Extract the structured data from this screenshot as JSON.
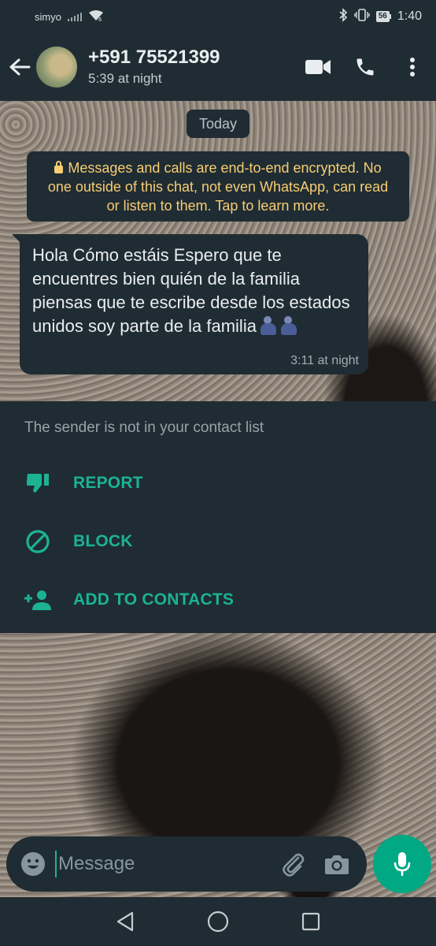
{
  "status_bar": {
    "carrier": "simyo",
    "battery": "56",
    "time": "1:40",
    "icons": [
      "signal-icon",
      "wifi-icon",
      "bluetooth-icon",
      "vibrate-icon",
      "battery-icon"
    ]
  },
  "header": {
    "contact_name": "+591 75521399",
    "contact_status": "5:39 at night",
    "icons": [
      "back-arrow-icon",
      "video-call-icon",
      "voice-call-icon",
      "more-vert-icon"
    ]
  },
  "chat": {
    "date_chip": "Today",
    "encryption_notice": "Messages and calls are end-to-end encrypted. No one outside of this chat, not even WhatsApp, can read or listen to them. Tap to learn more.",
    "messages": [
      {
        "direction": "incoming",
        "text": "Hola Cómo estáis Espero que te encuentres bien quién de la familia piensas que te escribe desde los estados unidos soy parte de la familia",
        "emojis": [
          "people-hugging-emoji",
          "people-hugging-emoji"
        ],
        "time": "3:11 at night"
      }
    ]
  },
  "unknown_sender_panel": {
    "note": "The sender is not in your contact list",
    "actions": [
      {
        "label": "REPORT",
        "icon": "thumbs-down-icon"
      },
      {
        "label": "BLOCK",
        "icon": "block-icon"
      },
      {
        "label": "ADD TO CONTACTS",
        "icon": "add-person-icon"
      }
    ]
  },
  "composer": {
    "placeholder": "Message",
    "icons": [
      "emoji-icon",
      "attach-icon",
      "camera-icon",
      "mic-icon"
    ]
  },
  "navbar": {
    "icons": [
      "nav-back-icon",
      "nav-home-icon",
      "nav-recents-icon"
    ]
  },
  "colors": {
    "bar": "#202c33",
    "accent": "#00a884",
    "action_text": "#1cb294",
    "notice_text": "#f7cd73"
  }
}
